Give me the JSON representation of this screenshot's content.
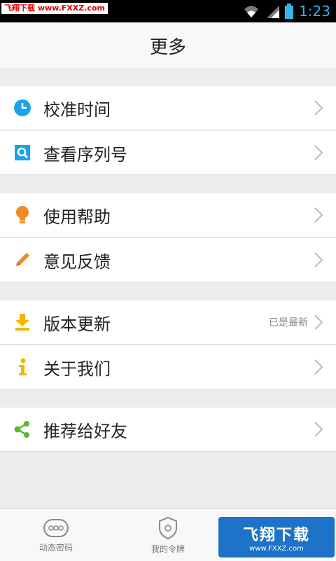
{
  "status_bar": {
    "watermark": "飞翔下载 www.FXXZ.com",
    "time": "1:23",
    "icons": [
      "wifi-icon",
      "signal-icon",
      "battery-icon"
    ]
  },
  "header": {
    "title": "更多"
  },
  "menu": {
    "items": [
      {
        "label": "校准时间",
        "icon": "clock-icon",
        "hint": ""
      },
      {
        "label": "查看序列号",
        "icon": "search-icon",
        "hint": ""
      },
      {
        "label": "使用帮助",
        "icon": "lightbulb-icon",
        "hint": ""
      },
      {
        "label": "意见反馈",
        "icon": "pencil-icon",
        "hint": ""
      },
      {
        "label": "版本更新",
        "icon": "download-icon",
        "hint": "已是最新"
      },
      {
        "label": "关于我们",
        "icon": "info-icon",
        "hint": ""
      },
      {
        "label": "推荐给好友",
        "icon": "share-icon",
        "hint": ""
      }
    ]
  },
  "tab_bar": {
    "tabs": [
      {
        "label": "动态密码",
        "icon": "dynamic-password-icon"
      },
      {
        "label": "我的令牌",
        "icon": "token-shield-icon"
      }
    ]
  },
  "watermark_logo": {
    "main": "飞翔下载",
    "sub": "www.FXXZ.com"
  },
  "colors": {
    "accent": "#33b5e5",
    "clock": "#1aa3e8",
    "bulb": "#f08a24",
    "download": "#f2b705",
    "share": "#5cb82c"
  }
}
